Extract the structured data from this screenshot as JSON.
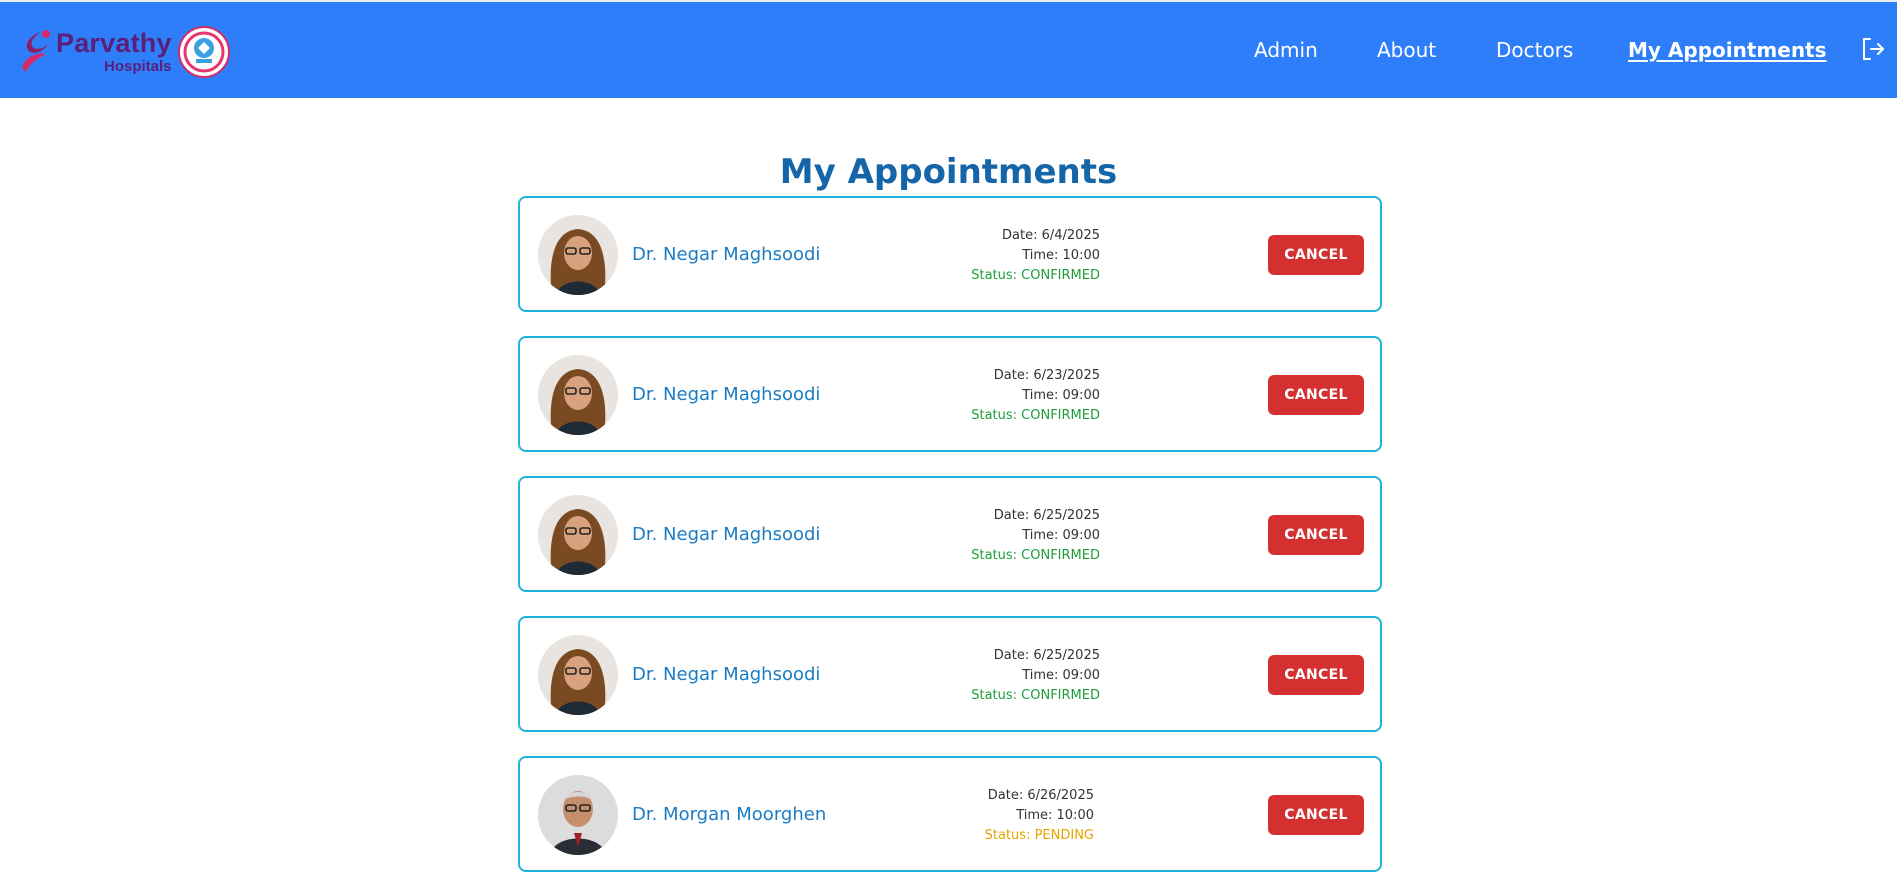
{
  "brand": {
    "name": "Parvathy",
    "sub": "Hospitals"
  },
  "nav": {
    "items": [
      "Admin",
      "About",
      "Doctors",
      "My Appointments"
    ],
    "active": "My Appointments"
  },
  "page": {
    "title": "My Appointments"
  },
  "appointments": [
    {
      "doctor": "Dr. Negar Maghsoodi",
      "date": "Date: 6/4/2025",
      "time": "Time: 10:00",
      "status": "Status: CONFIRMED",
      "status_kind": "confirmed",
      "action": "CANCEL",
      "avatar": "female"
    },
    {
      "doctor": "Dr. Negar Maghsoodi",
      "date": "Date: 6/23/2025",
      "time": "Time: 09:00",
      "status": "Status: CONFIRMED",
      "status_kind": "confirmed",
      "action": "CANCEL",
      "avatar": "female"
    },
    {
      "doctor": "Dr. Negar Maghsoodi",
      "date": "Date: 6/25/2025",
      "time": "Time: 09:00",
      "status": "Status: CONFIRMED",
      "status_kind": "confirmed",
      "action": "CANCEL",
      "avatar": "female"
    },
    {
      "doctor": "Dr. Negar Maghsoodi",
      "date": "Date: 6/25/2025",
      "time": "Time: 09:00",
      "status": "Status: CONFIRMED",
      "status_kind": "confirmed",
      "action": "CANCEL",
      "avatar": "female"
    },
    {
      "doctor": "Dr. Morgan Moorghen",
      "date": "Date: 6/26/2025",
      "time": "Time: 10:00",
      "status": "Status: PENDING",
      "status_kind": "pending",
      "action": "CANCEL",
      "avatar": "male"
    }
  ],
  "colors": {
    "navbar": "#2f7ef9",
    "title": "#1566a8",
    "card_border": "#1fb3de",
    "doctor_name": "#1a7cc4",
    "confirmed": "#1f9d3a",
    "pending": "#e6a400",
    "cancel_button": "#d3302f"
  },
  "icons": {
    "logout": "logout-icon"
  }
}
